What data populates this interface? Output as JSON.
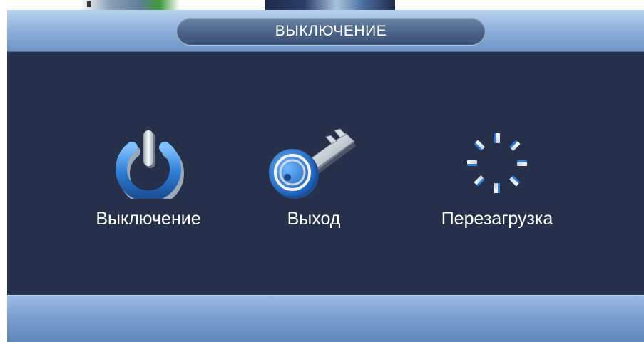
{
  "dialog": {
    "title": "ВЫКЛЮЧЕНИЕ"
  },
  "options": [
    {
      "label": "Выключение",
      "icon": "power-icon"
    },
    {
      "label": "Выход",
      "icon": "key-icon"
    },
    {
      "label": "Перезагрузка",
      "icon": "restart-spinner-icon"
    }
  ],
  "colors": {
    "background": "#27304a",
    "titlebar": "#8fb2da",
    "title_pill": "#4b6387",
    "icon_blue": "#3a86d6",
    "icon_silver": "#d9dde3",
    "text": "#ffffff"
  }
}
